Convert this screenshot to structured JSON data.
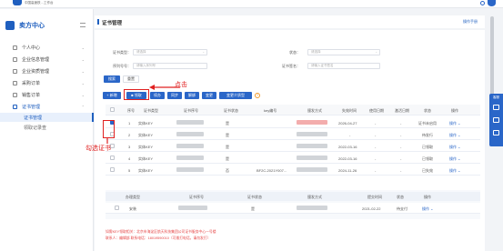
{
  "header": {
    "logo_text": "中国高速铁…工作台"
  },
  "sidebar": {
    "brand": "卖方中心",
    "items": [
      {
        "label": "个人中心",
        "chevron": "⌄"
      },
      {
        "label": "企业信息管理",
        "chevron": "⌄"
      },
      {
        "label": "企业资质管理",
        "chevron": "⌄"
      },
      {
        "label": "采购订单",
        "chevron": "⌄"
      },
      {
        "label": "销售订单",
        "chevron": "⌄"
      },
      {
        "label": "证书管理",
        "chevron": "⌃"
      }
    ],
    "sub_items": [
      {
        "label": "证书管理"
      },
      {
        "label": "领取记录查"
      }
    ]
  },
  "page": {
    "title": "证书管理",
    "help_link": "操作手册"
  },
  "filters": {
    "cert_type_label": "证书类型：",
    "cert_type_placeholder": "请选择",
    "status_label": "状态：",
    "status_placeholder": "请选择",
    "serial_label": "序列号号：",
    "serial_placeholder": "请输入序列号",
    "issuer_label": "证书签名：",
    "issuer_placeholder": "请输入证书签名",
    "search_button": "搜索",
    "reset_button": "重置"
  },
  "toolbar": {
    "add_button": "+ 新增",
    "claim_button": "■ 领取",
    "renew_button": "续办",
    "sync_button": "同步",
    "unbind_button": "解绑",
    "change_button": "变更",
    "change_device_button": "变更介质型",
    "info_icon": "?"
  },
  "table": {
    "headers": [
      "序号",
      "证书类型",
      "证书序号",
      "证书状态",
      "key编号",
      "颁发方式",
      "失效时间",
      "使用日期",
      "激活日期",
      "状态",
      "操作"
    ],
    "rows": [
      {
        "index": "1",
        "type": "实体KEY",
        "status_mark": "是",
        "expire": "2026-04-27",
        "use_date": "-",
        "act_date": "-",
        "state": "证书未启用",
        "op": "操作 ⌄"
      },
      {
        "index": "2",
        "type": "实体KEY",
        "status_mark": "是",
        "expire": "-",
        "use_date": "-",
        "act_date": "-",
        "state": "待发行",
        "op": "操作 ⌄"
      },
      {
        "index": "3",
        "type": "实体KEY",
        "status_mark": "是",
        "expire": "2022-03-16",
        "use_date": "-",
        "act_date": "-",
        "state": "已领取",
        "op": "操作 ⌄"
      },
      {
        "index": "4",
        "type": "实体KEY",
        "status_mark": "是",
        "expire": "2022-03-16",
        "use_date": "-",
        "act_date": "-",
        "state": "已领取",
        "op": "操作 ⌄"
      },
      {
        "index": "5",
        "type": "实体KEY",
        "status_mark": "否",
        "key_no": "BF2C-2021Y007...",
        "expire": "2024-11-26",
        "use_date": "-",
        "act_date": "-",
        "state": "已失效",
        "op": "操作 ⌄"
      }
    ]
  },
  "sub_table": {
    "headers": [
      "办理类型",
      "证书序号",
      "证书状态",
      "颁发方式",
      "提交时间",
      "状态",
      "操作"
    ],
    "row": {
      "type": "安装",
      "status_mark": "是",
      "date": "2021-02-22",
      "state": "待支付",
      "op": "操作 ⌄"
    }
  },
  "notice": {
    "line1": "如需KEY领取相关：北京市海淀区航天科技集团公司证书服务中心一号楼",
    "line2": "联系人：编辑部 联系电话：18019590010（可拨打电话，请勿发打）"
  },
  "float_bar": {
    "label": "客服"
  },
  "annotations": {
    "click_label": "点击",
    "check_label": "勾选证书"
  }
}
